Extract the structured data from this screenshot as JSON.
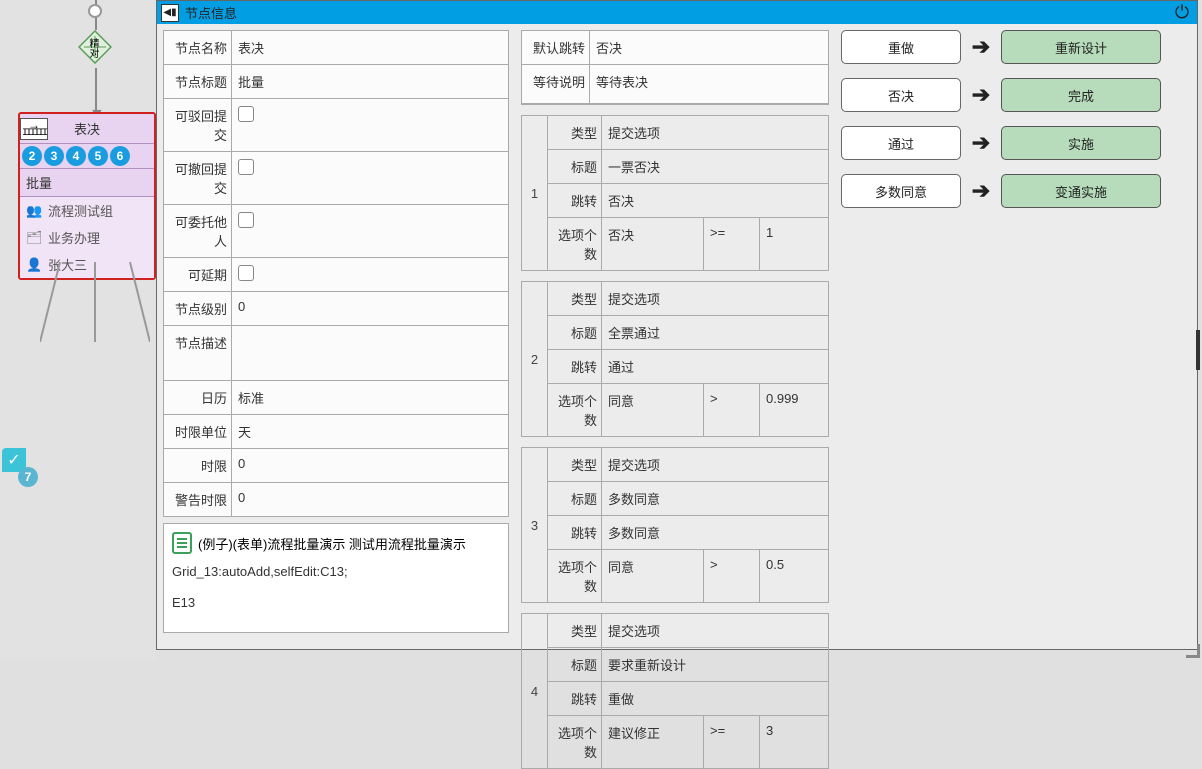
{
  "header": {
    "title": "节点信息"
  },
  "canvas": {
    "diamond_label": "精对",
    "node_title": "表决",
    "node_subtitle": "批量",
    "node_numbers": [
      "2",
      "3",
      "4",
      "5",
      "6"
    ],
    "node_items": [
      "流程测试组",
      "业务办理",
      "张大三"
    ],
    "extra_circle": "7"
  },
  "col1": {
    "rows": [
      {
        "label": "节点名称",
        "value": "表决",
        "type": "text"
      },
      {
        "label": "节点标题",
        "value": "批量",
        "type": "text"
      },
      {
        "label": "可驳回提交",
        "value": "",
        "type": "check"
      },
      {
        "label": "可撤回提交",
        "value": "",
        "type": "check"
      },
      {
        "label": "可委托他人",
        "value": "",
        "type": "check"
      },
      {
        "label": "可延期",
        "value": "",
        "type": "check"
      },
      {
        "label": "节点级别",
        "value": "0",
        "type": "text"
      },
      {
        "label": "节点描述",
        "value": "",
        "type": "desc"
      },
      {
        "label": "日历",
        "value": "标准",
        "type": "text"
      },
      {
        "label": "时限单位",
        "value": "天",
        "type": "text"
      },
      {
        "label": "时限",
        "value": "0",
        "type": "text"
      },
      {
        "label": "警告时限",
        "value": "0",
        "type": "text"
      }
    ],
    "note_title": "(例子)(表单)流程批量演示   测试用流程批量演示",
    "note_line1": "Grid_13:autoAdd,selfEdit:C13;",
    "note_line2": "E13"
  },
  "col2": {
    "default_jump_label": "默认跳转",
    "default_jump_value": "否决",
    "wait_label": "等待说明",
    "wait_value": "等待表决",
    "option_labels": {
      "type": "类型",
      "title": "标题",
      "jump": "跳转",
      "count": "选项个数"
    },
    "options": [
      {
        "n": "1",
        "type": "提交选项",
        "title": "一票否决",
        "jump": "否决",
        "count_kind": "否决",
        "op": ">=",
        "num": "1"
      },
      {
        "n": "2",
        "type": "提交选项",
        "title": "全票通过",
        "jump": "通过",
        "count_kind": "同意",
        "op": ">",
        "num": "0.999"
      },
      {
        "n": "3",
        "type": "提交选项",
        "title": "多数同意",
        "jump": "多数同意",
        "count_kind": "同意",
        "op": ">",
        "num": "0.5"
      },
      {
        "n": "4",
        "type": "提交选项",
        "title": "要求重新设计",
        "jump": "重做",
        "count_kind": "建议修正",
        "op": ">=",
        "num": "3"
      }
    ]
  },
  "col3": {
    "actions": [
      {
        "left": "重做",
        "right": "重新设计"
      },
      {
        "left": "否决",
        "right": "完成"
      },
      {
        "left": "通过",
        "right": "实施"
      },
      {
        "left": "多数同意",
        "right": "变通实施"
      }
    ]
  }
}
